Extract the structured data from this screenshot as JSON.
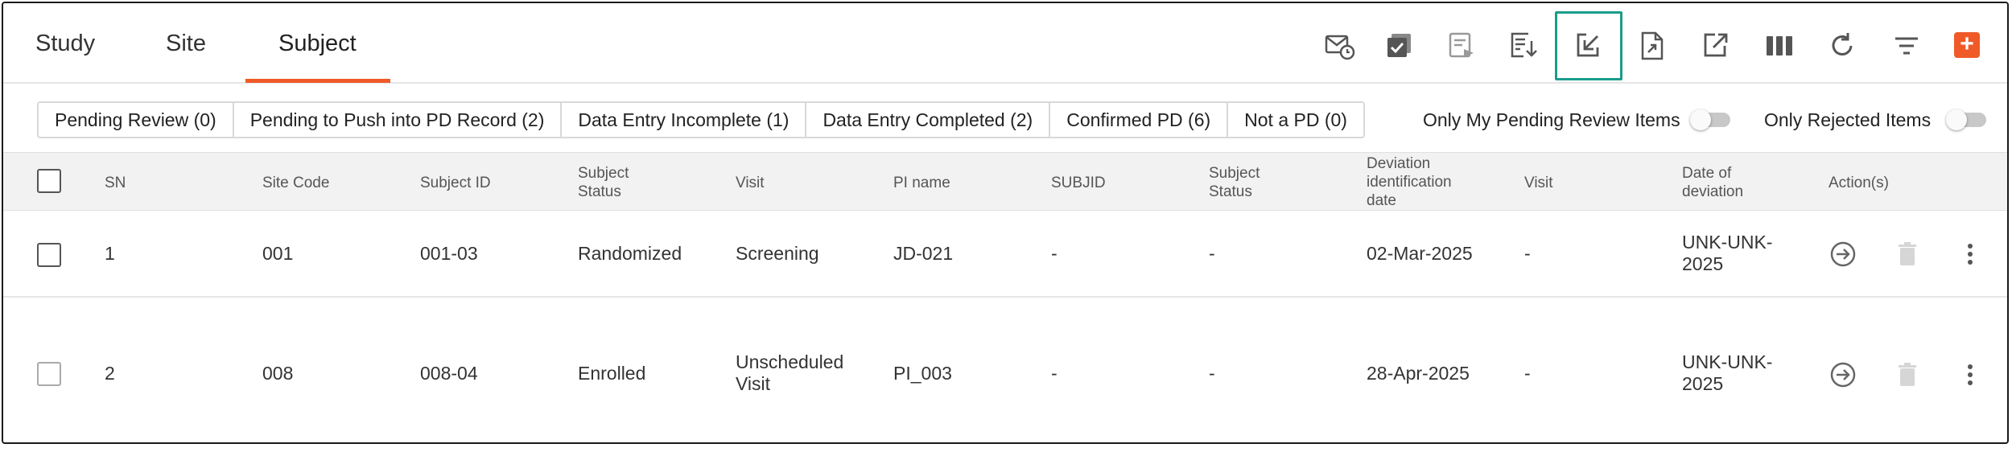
{
  "tabs": [
    {
      "label": "Study"
    },
    {
      "label": "Site"
    },
    {
      "label": "Subject"
    }
  ],
  "active_tab": "Subject",
  "toolbar": {
    "icons": [
      "mail-schedule-icon",
      "checklist-icon",
      "form-send-icon",
      "form-download-icon",
      "import-icon",
      "export-file-icon",
      "open-external-icon",
      "columns-icon",
      "refresh-icon",
      "filter-icon",
      "add-icon"
    ],
    "add_label": "+"
  },
  "filters": [
    {
      "label": "Pending Review (0)"
    },
    {
      "label": "Pending to Push into PD Record (2)"
    },
    {
      "label": "Data Entry Incomplete (1)"
    },
    {
      "label": "Data Entry Completed (2)"
    },
    {
      "label": "Confirmed PD (6)"
    },
    {
      "label": "Not a PD (0)"
    }
  ],
  "toggles": [
    {
      "label": "Only My Pending Review Items",
      "on": false
    },
    {
      "label": "Only Rejected Items",
      "on": false
    }
  ],
  "table": {
    "columns": [
      {
        "label": "SN"
      },
      {
        "label": "Site Code"
      },
      {
        "label": "Subject ID"
      },
      {
        "line1": "Subject",
        "line2": "Status"
      },
      {
        "label": "Visit"
      },
      {
        "label": "PI name"
      },
      {
        "label": "SUBJID"
      },
      {
        "line1": "Subject",
        "line2": "Status"
      },
      {
        "line1": "Deviation",
        "line2": "identification",
        "line3": "date"
      },
      {
        "label": "Visit"
      },
      {
        "line1": "Date of",
        "line2": "deviation"
      },
      {
        "label": "Action(s)"
      }
    ],
    "rows": [
      {
        "sn": "1",
        "site_code": "001",
        "subject_id": "001-03",
        "subject_status": "Randomized",
        "visit": "Screening",
        "visit2": "",
        "pi_name": "JD-021",
        "subjid": "-",
        "subject_status2": "-",
        "dev_id_date": "02-Mar-2025",
        "visit_b": "-",
        "date_dev1": "UNK-UNK-",
        "date_dev2": "2025"
      },
      {
        "sn": "2",
        "site_code": "008",
        "subject_id": "008-04",
        "subject_status": "Enrolled",
        "visit": "Unscheduled",
        "visit2": "Visit",
        "pi_name": "PI_003",
        "subjid": "-",
        "subject_status2": "-",
        "dev_id_date": "28-Apr-2025",
        "visit_b": "-",
        "date_dev1": "UNK-UNK-",
        "date_dev2": "2025"
      }
    ]
  },
  "colors": {
    "accent": "#f05a28",
    "highlight": "#1a9c8b",
    "icon": "#555555"
  }
}
